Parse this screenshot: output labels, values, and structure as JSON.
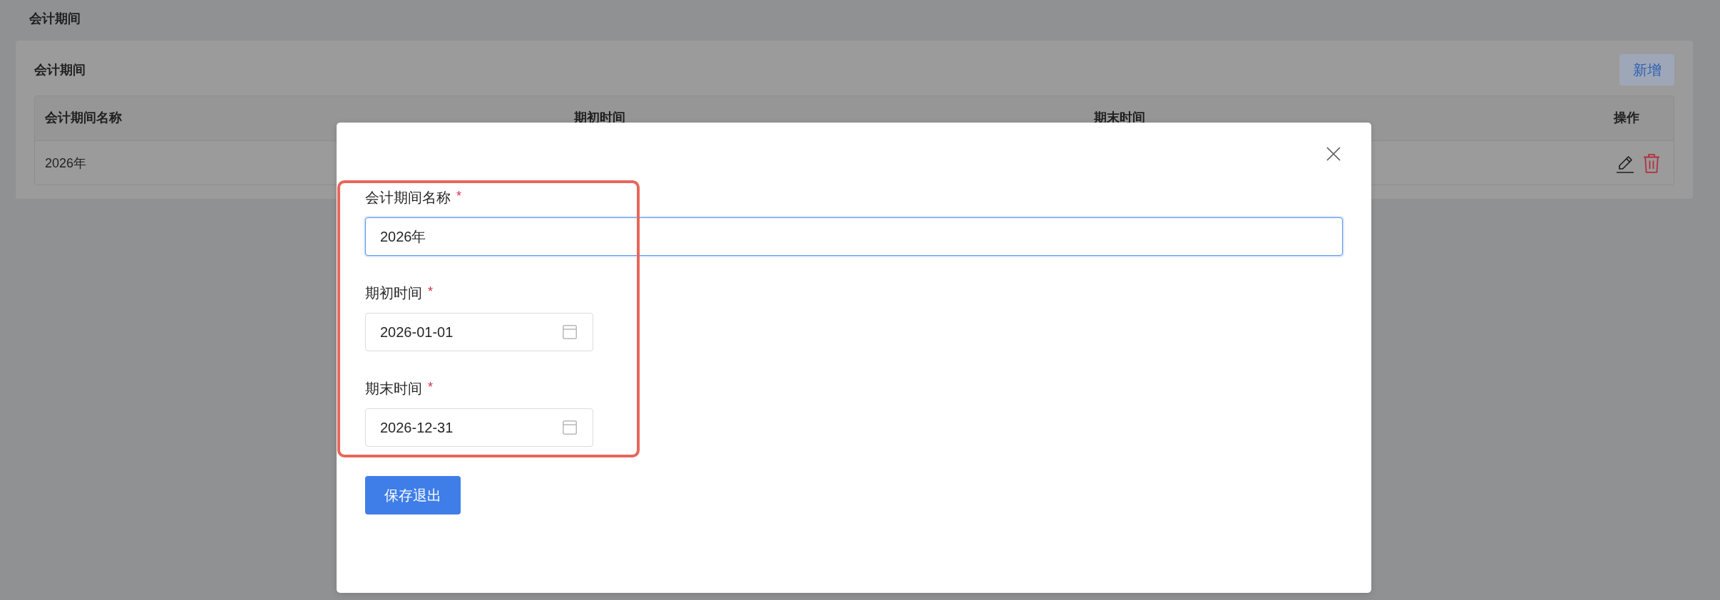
{
  "page": {
    "title": "会计期间"
  },
  "card": {
    "title": "会计期间",
    "add_button": "新增"
  },
  "table": {
    "columns": [
      "会计期间名称",
      "期初时间",
      "期末时间",
      "操作"
    ],
    "rows": [
      {
        "cells": [
          "2026年"
        ],
        "actions": [
          {
            "kind": "edit"
          },
          {
            "kind": "delete"
          }
        ]
      }
    ]
  },
  "modal": {
    "fields": [
      {
        "kind": "text",
        "label": "会计期间名称",
        "required_mark": "*",
        "value": "2026年",
        "focused": true
      },
      {
        "kind": "date",
        "label": "期初时间",
        "required_mark": "*",
        "value": "2026-01-01",
        "focused": false
      },
      {
        "kind": "date",
        "label": "期末时间",
        "required_mark": "*",
        "value": "2026-12-31",
        "focused": false
      }
    ],
    "submit_button": "保存退出"
  }
}
